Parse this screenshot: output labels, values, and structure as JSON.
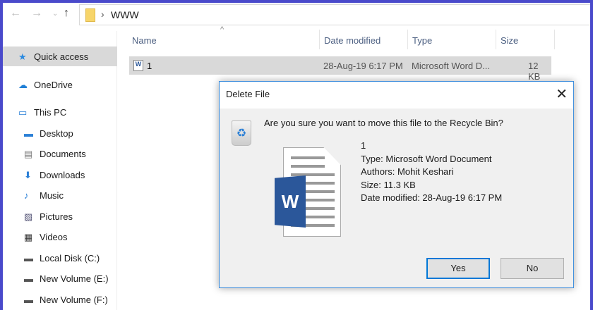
{
  "address": {
    "path": "WWW"
  },
  "nav": [
    {
      "label": "Quick access",
      "icon": "star-icon"
    },
    {
      "label": "OneDrive",
      "icon": "cloud-icon"
    },
    {
      "label": "This PC",
      "icon": "computer-icon"
    },
    {
      "label": "Desktop",
      "icon": "desktop-icon"
    },
    {
      "label": "Documents",
      "icon": "documents-icon"
    },
    {
      "label": "Downloads",
      "icon": "download-icon"
    },
    {
      "label": "Music",
      "icon": "music-icon"
    },
    {
      "label": "Pictures",
      "icon": "pictures-icon"
    },
    {
      "label": "Videos",
      "icon": "videos-icon"
    },
    {
      "label": "Local Disk (C:)",
      "icon": "drive-icon"
    },
    {
      "label": "New Volume (E:)",
      "icon": "drive-icon"
    },
    {
      "label": "New Volume (F:)",
      "icon": "drive-icon"
    }
  ],
  "columns": {
    "name": "Name",
    "date": "Date modified",
    "type": "Type",
    "size": "Size"
  },
  "file": {
    "name": "1",
    "date": "28-Aug-19 6:17 PM",
    "type": "Microsoft Word D...",
    "size": "12 KB"
  },
  "dialog": {
    "title": "Delete File",
    "question": "Are you sure you want to move this file to the Recycle Bin?",
    "name": "1",
    "type": "Type: Microsoft Word Document",
    "authors": "Authors: Mohit Keshari",
    "size": "Size: 11.3 KB",
    "modified": "Date modified: 28-Aug-19 6:17 PM",
    "yes": "Yes",
    "no": "No",
    "logo_letter": "W"
  }
}
